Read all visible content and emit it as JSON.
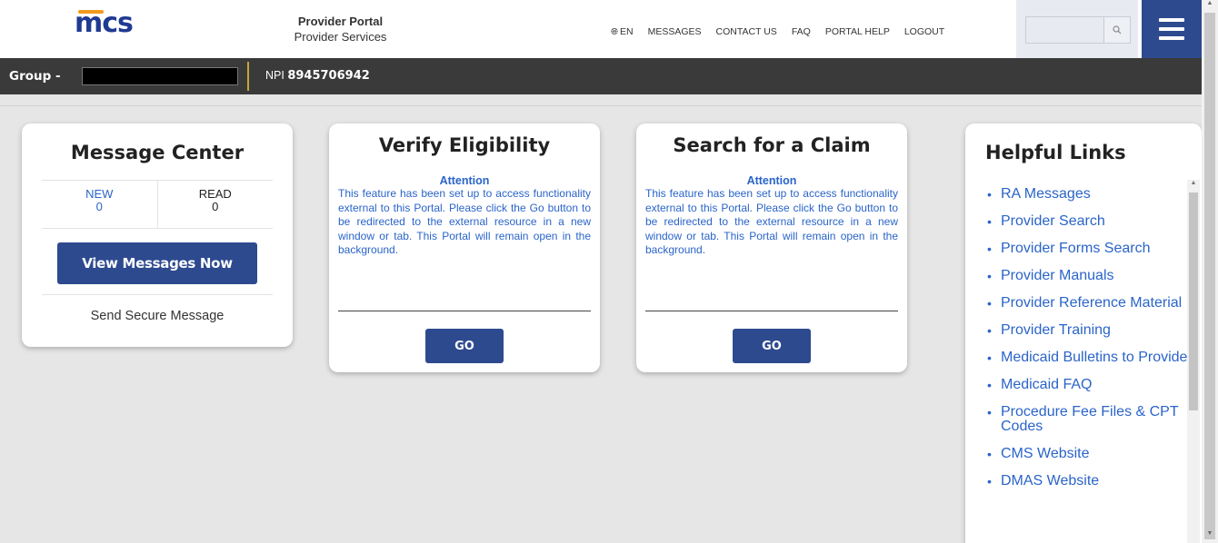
{
  "header": {
    "logo_text": "mcs",
    "portal_title": "Provider Portal",
    "portal_subtitle": "Provider Services",
    "nav": {
      "language": "EN",
      "messages": "MESSAGES",
      "contact": "CONTACT US",
      "faq": "FAQ",
      "portal_help": "PORTAL HELP",
      "logout": "LOGOUT"
    },
    "search": {
      "value": "",
      "icon": "search-icon"
    },
    "menu_icon": "hamburger-menu-icon"
  },
  "groupbar": {
    "group_label": "Group -",
    "npi_label": "NPI",
    "npi_value": "8945706942"
  },
  "message_center": {
    "title": "Message Center",
    "new_label": "NEW",
    "new_count": "0",
    "read_label": "READ",
    "read_count": "0",
    "view_button": "View Messages Now",
    "send_link": "Send Secure Message"
  },
  "verify_eligibility": {
    "title": "Verify Eligibility",
    "attention_title": "Attention",
    "attention_body": "This feature has been set up to access functionality external to this Portal. Please click the Go button to be redirected to the external resource in a new window or tab. This Portal will remain open in the background.",
    "go_button": "GO"
  },
  "search_claim": {
    "title": "Search for a Claim",
    "attention_title": "Attention",
    "attention_body": "This feature has been set up to access functionality external to this Portal. Please click the Go button to be redirected to the external resource in a new window or tab. This Portal will remain open in the background.",
    "go_button": "GO"
  },
  "helpful_links": {
    "title": "Helpful Links",
    "items": [
      "RA Messages",
      "Provider Search",
      "Provider Forms Search",
      "Provider Manuals",
      "Provider Reference Material",
      "Provider Training",
      "Medicaid Bulletins to Provider",
      "Medicaid FAQ",
      "Procedure Fee Files & CPT Codes",
      "CMS Website",
      "DMAS Website"
    ]
  },
  "colors": {
    "brand_blue": "#2e4a8f",
    "link_blue": "#2a64c9",
    "logo_orange": "#f29a1f",
    "group_bar": "#3a3a3a"
  }
}
